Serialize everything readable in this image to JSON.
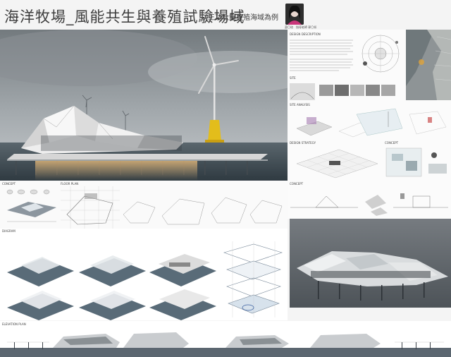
{
  "header": {
    "title": "海洋牧場_風能共生與養殖試驗場域",
    "subtitle": "以王功杜鱺養殖海域為例",
    "student_label": "蕭〇瑄",
    "advisor_label": "指導老師 郭〇如"
  },
  "sections": {
    "design_description": "DESIGN DESCRIPTION",
    "site": "SITE",
    "site_analysis": "SITE ANALYSIS",
    "design_strategy": "DESIGN STRATEGY",
    "concept_right": "CONCEPT",
    "concept_right2": "CONCEPT",
    "concept_left": "CONCEPT",
    "floor_plan": "FLOOR PLAN",
    "diagram": "DIAGRAM",
    "elevation_plan": "ELEVATION PLAN"
  },
  "colors": {
    "sky_top": "#7d8387",
    "sky_bottom": "#b9bec1",
    "sea": "#3d4a52",
    "building": "#e8e8e8",
    "turbine_base": "#e7c01a",
    "light": "#f1b56a"
  }
}
